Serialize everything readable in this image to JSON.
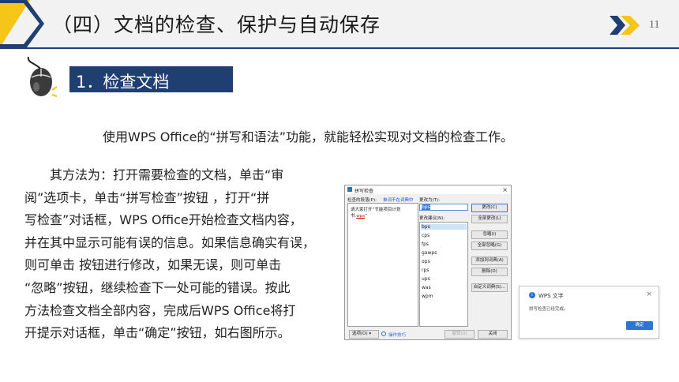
{
  "header": {
    "title": "（四）文档的检查、保护与自动保存",
    "page_number": "11"
  },
  "section": {
    "title": "1．检查文档"
  },
  "intro": "使用WPS Office的“拼写和语法”功能，就能轻松实现对文档的检查工作。",
  "paragraph_lines": [
    "　　其方法为：打开需要检查的文档，单击“审",
    "阅”选项卡，单击“拼写检查”按钮 ，打开“拼",
    "写检查”对话框，WPS Office开始检查文档内容，",
    "并在其中显示可能有误的信息。如果信息确实有误，",
    "则可单击 按钮进行修改，如果无误，则可单击",
    " “忽略”按钮，继续检查下一处可能的错误。按此",
    "方法检查文档全部内容，完成后WPS Office将打",
    "开提示对话框，单击“确定”按钮，如右图所示。"
  ],
  "spell_dialog": {
    "title": "拼写检查",
    "close": "×",
    "not_in_dict_label": "检查的段落(P):",
    "not_in_dict_status": "单词不在词典中",
    "change_to_label": "更改为(T):",
    "text_line1": "请大家打开“节能项目计划",
    "text_line2_prefix": "书.",
    "text_line2_error": "wps",
    "text_line2_suffix": "”",
    "change_to_value": "bps",
    "suggestions_label": "更改建议(N):",
    "suggestions": [
      "bps",
      "cps",
      "fps",
      "gawps",
      "ops",
      "rps",
      "ups",
      "was",
      "wpm"
    ],
    "buttons": {
      "change": "更改(C)",
      "change_all": "全部更改(L)",
      "ignore": "忽略(I)",
      "ignore_all": "全部忽略(G)",
      "add_to_dict": "添加到词典(A)",
      "delete": "删除(D)",
      "custom_dict": "自定义词典(S)...",
      "undo": "撤销(U)",
      "close": "关闭"
    },
    "options": "选项(O)",
    "tips": "操作技巧"
  },
  "message_box": {
    "title": "WPS 文字",
    "close": "×",
    "text": "拼写检查已经完成。",
    "ok": "确定"
  },
  "colors": {
    "navy": "#1f3f72",
    "yellow": "#f5c518",
    "accent_blue": "#2f74d0"
  }
}
